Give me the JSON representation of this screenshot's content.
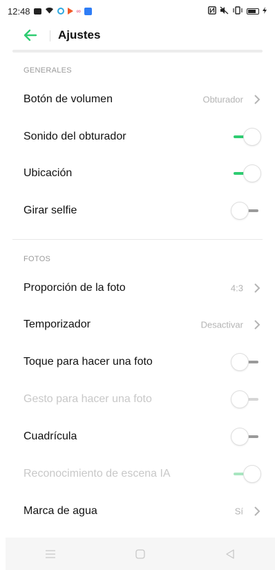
{
  "status_bar": {
    "time": "12:48"
  },
  "header": {
    "title": "Ajustes"
  },
  "colors": {
    "accent": "#2ecc71",
    "secondary_text": "#b4b4b4"
  },
  "sections": {
    "general": {
      "label": "GENERALES",
      "rows": [
        {
          "label": "Botón de volumen",
          "value": "Obturador",
          "type": "select"
        },
        {
          "label": "Sonido del obturador",
          "type": "toggle",
          "on": true
        },
        {
          "label": "Ubicación",
          "type": "toggle",
          "on": true
        },
        {
          "label": "Girar selfie",
          "type": "toggle",
          "on": false
        }
      ]
    },
    "photos": {
      "label": "FOTOS",
      "rows": [
        {
          "label": "Proporción de la foto",
          "value": "4:3",
          "type": "select"
        },
        {
          "label": "Temporizador",
          "value": "Desactivar",
          "type": "select"
        },
        {
          "label": "Toque para hacer una foto",
          "type": "toggle",
          "on": false
        },
        {
          "label": "Gesto para hacer una foto",
          "type": "toggle",
          "on": false,
          "disabled": true
        },
        {
          "label": "Cuadrícula",
          "type": "toggle",
          "on": false
        },
        {
          "label": "Reconocimiento de escena IA",
          "type": "toggle",
          "on": true,
          "disabled": true
        },
        {
          "label": "Marca de agua",
          "value": "Sí",
          "type": "select"
        }
      ]
    }
  },
  "nav": {
    "icons": [
      "menu-icon",
      "home-icon",
      "back-triangle-icon"
    ]
  }
}
